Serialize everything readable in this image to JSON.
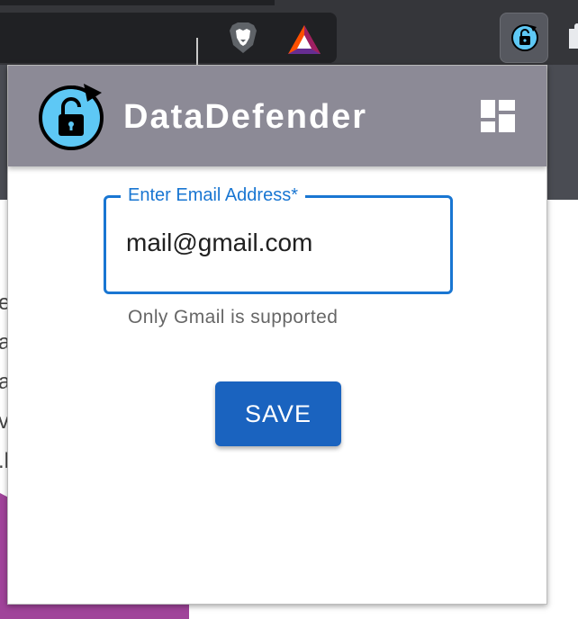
{
  "browser": {
    "toolbar_icons": [
      "brave-lion-icon",
      "bat-rewards-icon",
      "extension-lock-icon",
      "puzzle-icon"
    ]
  },
  "background_page": {
    "fragments": [
      "ec",
      "a",
      "a",
      "vi",
      ".h"
    ]
  },
  "popup": {
    "app_title": "DataDefender",
    "logo_icon": "lock-refresh-icon",
    "menu_icon": "dashboard-icon",
    "email_field": {
      "label": "Enter Email Address",
      "required_mark": "*",
      "value": "mail@gmail.com",
      "helper": "Only Gmail is supported"
    },
    "save_label": "SAVE"
  },
  "colors": {
    "header": "#8c8a96",
    "accent": "#1976d2",
    "button": "#1a63bf",
    "logo_fill": "#5ec8f5"
  }
}
